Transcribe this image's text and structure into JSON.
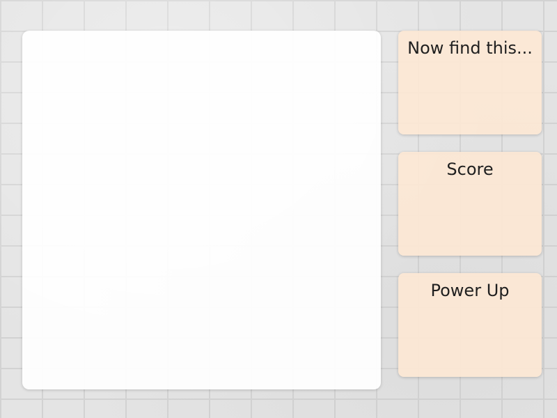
{
  "game": {
    "prompt_panel": {
      "title": "Now find this..."
    },
    "score_panel": {
      "title": "Score"
    },
    "powerup_panel": {
      "title": "Power Up"
    }
  }
}
